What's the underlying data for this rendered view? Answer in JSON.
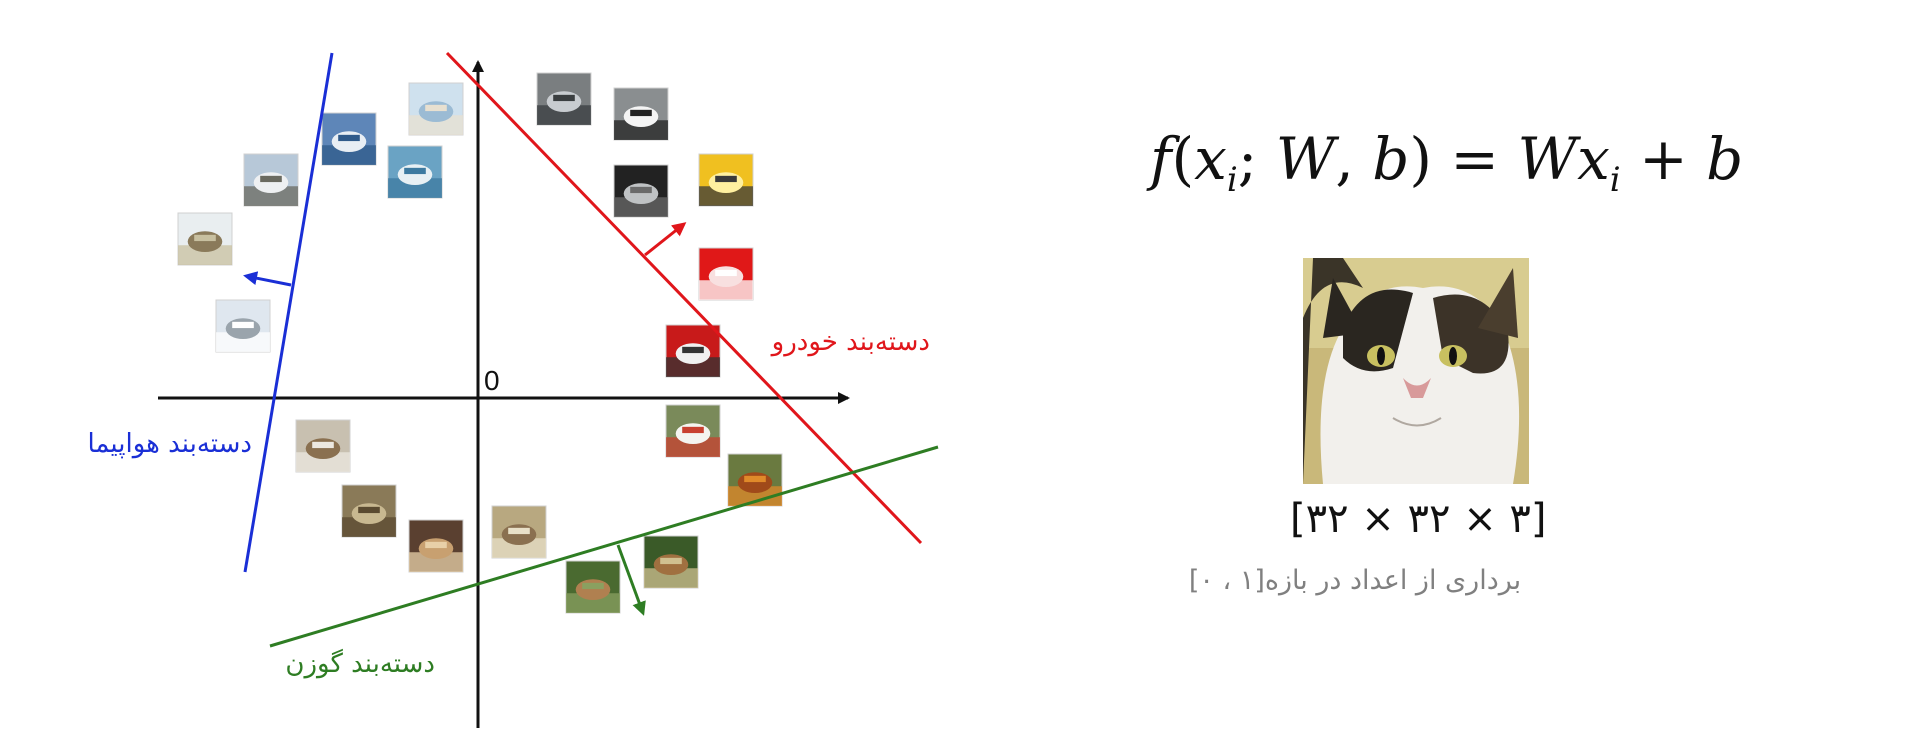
{
  "diagram": {
    "origin_label": "0",
    "classifiers": [
      {
        "id": "airplane",
        "label": "دسته‌بند هواپیما",
        "color": "#1a2fd6"
      },
      {
        "id": "car",
        "label": "دسته‌بند خودرو",
        "color": "#e0161b"
      },
      {
        "id": "deer",
        "label": "دسته‌بند گوزن",
        "color": "#2e7d23"
      }
    ],
    "thumbnails": [
      {
        "name": "thumb-ship-1",
        "subject": "ship",
        "palette": [
          "#cfe1ee",
          "#9bbbd4",
          "#e8e0d0"
        ]
      },
      {
        "name": "thumb-ship-2",
        "subject": "ship",
        "palette": [
          "#5e86b8",
          "#e8eef4",
          "#2f5a8a"
        ]
      },
      {
        "name": "thumb-airplane-1",
        "subject": "airplane",
        "palette": [
          "#b7c8d8",
          "#eef0f2",
          "#6a6a60"
        ]
      },
      {
        "name": "thumb-ship-3",
        "subject": "ship",
        "palette": [
          "#6aa3c4",
          "#e8f0f4",
          "#3d7aa0"
        ]
      },
      {
        "name": "thumb-airplane-2",
        "subject": "airplane",
        "palette": [
          "#e9eef0",
          "#8a7a5a",
          "#c8c0a0"
        ]
      },
      {
        "name": "thumb-airplane-3",
        "subject": "airplane",
        "palette": [
          "#dfe7ef",
          "#9aa4ac",
          "#ffffff"
        ]
      },
      {
        "name": "thumb-car-1",
        "subject": "car",
        "palette": [
          "#7a7e80",
          "#c8ccd0",
          "#3a3e40"
        ]
      },
      {
        "name": "thumb-car-2",
        "subject": "car",
        "palette": [
          "#8a8e90",
          "#f4f4f4",
          "#222222"
        ]
      },
      {
        "name": "thumb-car-3",
        "subject": "car",
        "palette": [
          "#222222",
          "#bfc2c4",
          "#6a6a6a"
        ]
      },
      {
        "name": "thumb-car-4",
        "subject": "car",
        "palette": [
          "#f0c020",
          "#fff0a0",
          "#3a3a3a"
        ]
      },
      {
        "name": "thumb-car-5",
        "subject": "car",
        "palette": [
          "#e01818",
          "#f8e0e0",
          "#ffffff"
        ]
      },
      {
        "name": "thumb-truck-1",
        "subject": "truck",
        "palette": [
          "#c81a1a",
          "#f0f0f0",
          "#333333"
        ]
      },
      {
        "name": "thumb-bird-1",
        "subject": "bird",
        "palette": [
          "#7a8a5a",
          "#f4f4f0",
          "#c84030"
        ]
      },
      {
        "name": "thumb-bird-2",
        "subject": "bird",
        "palette": [
          "#6a7a40",
          "#a04a1a",
          "#e08a2a"
        ]
      },
      {
        "name": "thumb-cat-1",
        "subject": "cat",
        "palette": [
          "#c8c0b0",
          "#8a7050",
          "#ece8e0"
        ]
      },
      {
        "name": "thumb-frog-1",
        "subject": "frog",
        "palette": [
          "#8a7a58",
          "#c8b890",
          "#5a4a30"
        ]
      },
      {
        "name": "thumb-dog-1",
        "subject": "dog",
        "palette": [
          "#5a4030",
          "#c8a070",
          "#e8d0a8"
        ]
      },
      {
        "name": "thumb-bird-3",
        "subject": "bird",
        "palette": [
          "#b8a880",
          "#8a7050",
          "#e8e0c8"
        ]
      },
      {
        "name": "thumb-deer-1",
        "subject": "deer",
        "palette": [
          "#4a6a30",
          "#b08050",
          "#8aa060"
        ]
      },
      {
        "name": "thumb-deer-2",
        "subject": "deer",
        "palette": [
          "#3a5a28",
          "#a07040",
          "#d0c090"
        ]
      }
    ]
  },
  "formula": {
    "f": "f",
    "open": "(",
    "x": "x",
    "sub_i": "i",
    "semi": ";",
    "W": "W",
    "comma": ",",
    "b": "b",
    "close": ")",
    "eq": "=",
    "W2": "W",
    "x2": "x",
    "sub_i2": "i",
    "plus": "+",
    "b2": "b"
  },
  "image_panel": {
    "subject": "cat-photo",
    "dims_label": "[۳۲ × ۳۲ × ۳]",
    "range_label": "برداری از اعداد در بازه[۱ ، ۰]"
  }
}
